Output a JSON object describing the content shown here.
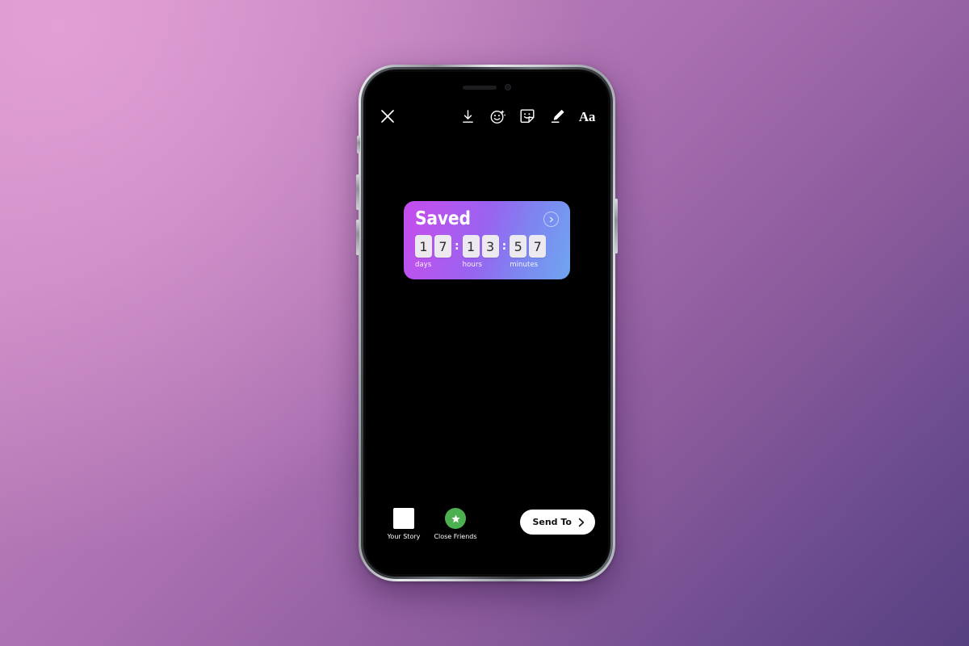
{
  "background": {
    "gradient_from": "#cf8fc3",
    "gradient_to": "#574080"
  },
  "device": {
    "name": "smartphone-mockup",
    "frame_color": "#b9bcc2",
    "screen_color": "#000000"
  },
  "app": {
    "name": "Instagram Story Editor",
    "screen_background": "#000000"
  },
  "top_bar": {
    "close_icon": "close-icon",
    "tools": [
      {
        "icon": "download-icon",
        "label": "Save"
      },
      {
        "icon": "effects-face-icon",
        "label": "Effects"
      },
      {
        "icon": "sticker-icon",
        "label": "Stickers"
      },
      {
        "icon": "draw-pen-icon",
        "label": "Draw"
      },
      {
        "icon": "text-aa-icon",
        "label": "Aa"
      }
    ],
    "text_tool_label": "Aa"
  },
  "sticker": {
    "type": "countdown",
    "title": "Saved",
    "arrow_icon": "chevron-right-circle-icon",
    "gradient_from": "#c44ceb",
    "gradient_to": "#6fa6ef",
    "separator": ":",
    "units": [
      {
        "label": "days",
        "digits": [
          "1",
          "7"
        ]
      },
      {
        "label": "hours",
        "digits": [
          "1",
          "3"
        ]
      },
      {
        "label": "minutes",
        "digits": [
          "5",
          "7"
        ]
      }
    ]
  },
  "bottom_bar": {
    "destinations": [
      {
        "label": "Your Story",
        "icon": "story-thumbnail-icon",
        "color": "#ffffff"
      },
      {
        "label": "Close Friends",
        "icon": "green-star-icon",
        "color": "#4caf50"
      }
    ],
    "send_button": {
      "label": "Send To",
      "icon": "chevron-right-icon"
    }
  }
}
